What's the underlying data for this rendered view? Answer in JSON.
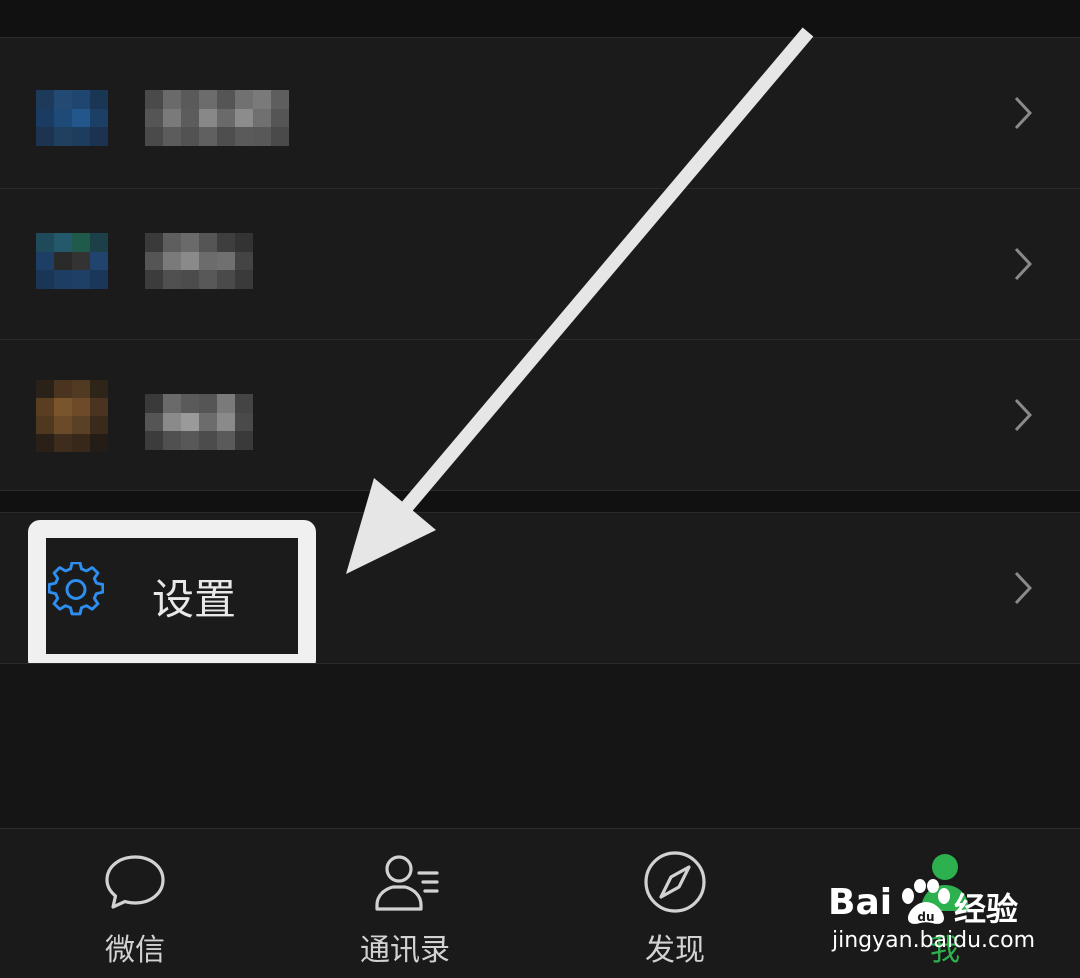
{
  "settings": {
    "label": "设置",
    "icon": "gear-icon",
    "icon_color": "#2e8ef0"
  },
  "rows": [
    {
      "avatar": "blurred-avatar",
      "name": ""
    },
    {
      "avatar": "blurred-avatar",
      "name": ""
    },
    {
      "avatar": "blurred-avatar",
      "name": ""
    }
  ],
  "tabbar": {
    "tabs": [
      {
        "label": "微信",
        "icon": "chat-bubble-icon"
      },
      {
        "label": "通讯录",
        "icon": "contacts-icon"
      },
      {
        "label": "发现",
        "icon": "compass-icon"
      },
      {
        "label": "我",
        "icon": "person-icon",
        "active": true
      }
    ],
    "active_color": "#2db14f"
  },
  "watermark": {
    "brand": "Bai",
    "brand_suffix": "经验",
    "url": "jingyan.baidu.com"
  },
  "colors": {
    "background": "#111111",
    "row": "#1b1b1b",
    "highlight_box": "#f0f0f0",
    "arrow": "#e6e6e6"
  }
}
